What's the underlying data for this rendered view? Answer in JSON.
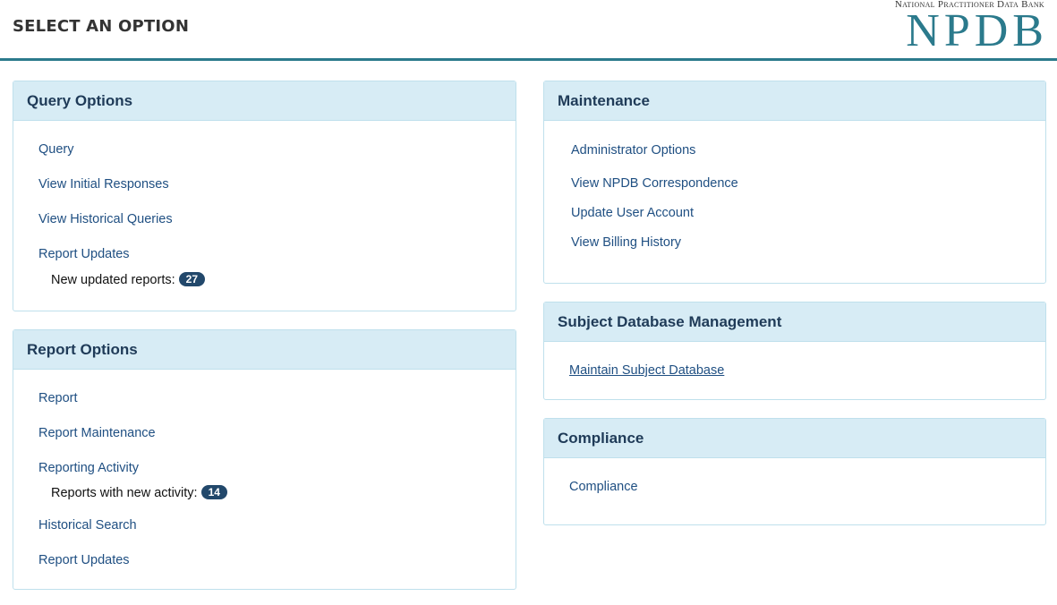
{
  "header": {
    "title": "SELECT AN OPTION",
    "logo_subtitle": "National Practitioner Data Bank",
    "logo_text": "NPDB"
  },
  "query_options": {
    "title": "Query Options",
    "links": [
      "Query",
      "View Initial Responses",
      "View Historical Queries",
      "Report Updates"
    ],
    "updated_label": "New updated reports:",
    "updated_count": "27"
  },
  "report_options": {
    "title": "Report Options",
    "links": [
      "Report",
      "Report Maintenance",
      "Reporting Activity",
      "Historical Search",
      "Report Updates"
    ],
    "activity_label": "Reports with new activity:",
    "activity_count": "14"
  },
  "maintenance": {
    "title": "Maintenance",
    "links": [
      "Administrator Options",
      "View NPDB Correspondence",
      "Update User Account",
      "View Billing History"
    ]
  },
  "subject_db": {
    "title": "Subject Database Management",
    "link": "Maintain Subject Database"
  },
  "compliance": {
    "title": "Compliance",
    "link": "Compliance"
  },
  "colors": {
    "accent": "#2b7a8c",
    "panel_header_bg": "#d7ecf5",
    "link": "#1f4f82",
    "badge": "#22486b"
  }
}
